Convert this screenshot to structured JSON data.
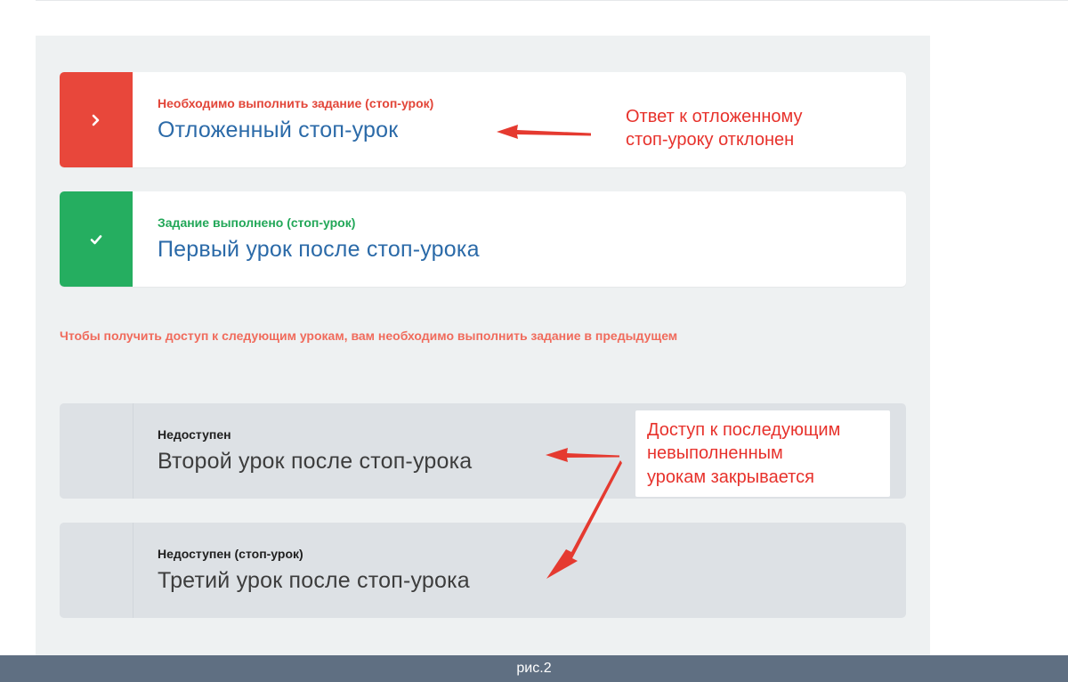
{
  "lessons": [
    {
      "status": "Необходимо выполнить задание (стоп-урок)",
      "title": "Отложенный стоп-урок",
      "icon": "chevron-right-icon",
      "state": "action-required"
    },
    {
      "status": "Задание выполнено (стоп-урок)",
      "title": "Первый урок после стоп-урока",
      "icon": "check-icon",
      "state": "done"
    },
    {
      "status": "Недоступен",
      "title": "Второй урок после стоп-урока",
      "state": "locked"
    },
    {
      "status": "Недоступен (стоп-урок)",
      "title": "Третий урок после стоп-урока",
      "state": "locked"
    }
  ],
  "notice": "Чтобы получить доступ к следующим урокам, вам необходимо выполнить задание в предыдущем",
  "annotations": {
    "rejected": [
      "Ответ к отложенному",
      "стоп-уроку отклонен"
    ],
    "closed": [
      "Доступ к последующим",
      "невыполненным",
      "урокам закрывается"
    ]
  },
  "caption": "рис.2",
  "colors": {
    "red": "#e8473b",
    "green": "#25ae60",
    "link": "#2b6aa8",
    "notice": "#f06b5c",
    "annotation": "#e7322c",
    "panel": "#eef1f2",
    "locked": "#dde1e5",
    "footer": "#5f6f82"
  }
}
